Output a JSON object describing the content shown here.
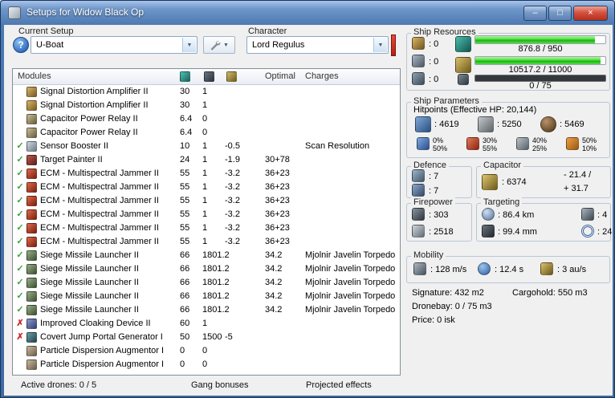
{
  "window": {
    "title": "Setups for Widow Black Op",
    "min_glyph": "–",
    "max_glyph": "□",
    "close_glyph": "×"
  },
  "controls": {
    "current_setup_label": "Current Setup",
    "setup_value": "U-Boat",
    "character_label": "Character",
    "character_value": "Lord Regulus",
    "help": "?",
    "dropdown_arrow": "▼"
  },
  "table": {
    "header": {
      "modules": "Modules",
      "optimal": "Optimal",
      "charges": "Charges"
    },
    "rows": [
      {
        "s": "",
        "name": "Signal Distortion Amplifier II",
        "cpu": "30",
        "qty": "1",
        "cap": "",
        "opt": "",
        "chg": ""
      },
      {
        "s": "",
        "name": "Signal Distortion Amplifier II",
        "cpu": "30",
        "qty": "1",
        "cap": "",
        "opt": "",
        "chg": ""
      },
      {
        "s": "",
        "name": "Capacitor Power Relay II",
        "cpu": "6.4",
        "qty": "0",
        "cap": "",
        "opt": "",
        "chg": ""
      },
      {
        "s": "",
        "name": "Capacitor Power Relay II",
        "cpu": "6.4",
        "qty": "0",
        "cap": "",
        "opt": "",
        "chg": ""
      },
      {
        "s": "✓",
        "name": "Sensor Booster II",
        "cpu": "10",
        "qty": "1",
        "cap": "-0.5",
        "opt": "",
        "chg": "Scan Resolution"
      },
      {
        "s": "✓",
        "name": "Target Painter II",
        "cpu": "24",
        "qty": "1",
        "cap": "-1.9",
        "opt": "30+78",
        "chg": ""
      },
      {
        "s": "✓",
        "name": "ECM - Multispectral Jammer II",
        "cpu": "55",
        "qty": "1",
        "cap": "-3.2",
        "opt": "36+23",
        "chg": ""
      },
      {
        "s": "✓",
        "name": "ECM - Multispectral Jammer II",
        "cpu": "55",
        "qty": "1",
        "cap": "-3.2",
        "opt": "36+23",
        "chg": ""
      },
      {
        "s": "✓",
        "name": "ECM - Multispectral Jammer II",
        "cpu": "55",
        "qty": "1",
        "cap": "-3.2",
        "opt": "36+23",
        "chg": ""
      },
      {
        "s": "✓",
        "name": "ECM - Multispectral Jammer II",
        "cpu": "55",
        "qty": "1",
        "cap": "-3.2",
        "opt": "36+23",
        "chg": ""
      },
      {
        "s": "✓",
        "name": "ECM - Multispectral Jammer II",
        "cpu": "55",
        "qty": "1",
        "cap": "-3.2",
        "opt": "36+23",
        "chg": ""
      },
      {
        "s": "✓",
        "name": "ECM - Multispectral Jammer II",
        "cpu": "55",
        "qty": "1",
        "cap": "-3.2",
        "opt": "36+23",
        "chg": ""
      },
      {
        "s": "✓",
        "name": "Siege Missile Launcher II",
        "cpu": "66",
        "qty": "1801.2",
        "cap": "",
        "opt": "34.2",
        "chg": "Mjolnir Javelin Torpedo"
      },
      {
        "s": "✓",
        "name": "Siege Missile Launcher II",
        "cpu": "66",
        "qty": "1801.2",
        "cap": "",
        "opt": "34.2",
        "chg": "Mjolnir Javelin Torpedo"
      },
      {
        "s": "✓",
        "name": "Siege Missile Launcher II",
        "cpu": "66",
        "qty": "1801.2",
        "cap": "",
        "opt": "34.2",
        "chg": "Mjolnir Javelin Torpedo"
      },
      {
        "s": "✓",
        "name": "Siege Missile Launcher II",
        "cpu": "66",
        "qty": "1801.2",
        "cap": "",
        "opt": "34.2",
        "chg": "Mjolnir Javelin Torpedo"
      },
      {
        "s": "✓",
        "name": "Siege Missile Launcher II",
        "cpu": "66",
        "qty": "1801.2",
        "cap": "",
        "opt": "34.2",
        "chg": "Mjolnir Javelin Torpedo"
      },
      {
        "s": "✗",
        "name": "Improved Cloaking Device II",
        "cpu": "60",
        "qty": "1",
        "cap": "",
        "opt": "",
        "chg": ""
      },
      {
        "s": "✗",
        "name": "Covert Jump Portal Generator I",
        "cpu": "50",
        "qty": "1500",
        "cap": "-5",
        "opt": "",
        "chg": ""
      },
      {
        "s": "",
        "name": "Particle Dispersion Augmentor I",
        "cpu": "0",
        "qty": "0",
        "cap": "",
        "opt": "",
        "chg": ""
      },
      {
        "s": "",
        "name": "Particle Dispersion Augmentor I",
        "cpu": "0",
        "qty": "0",
        "cap": "",
        "opt": "",
        "chg": ""
      }
    ]
  },
  "tabs": {
    "active_drones": "Active drones: 0 / 5",
    "gang_bonuses": "Gang bonuses",
    "projected_effects": "Projected effects"
  },
  "resources": {
    "title": "Ship Resources",
    "turrets": ": 0",
    "launchers": ": 0",
    "utility": ": 0",
    "cpu_text": "876.8 / 950",
    "cpu_pct": 92,
    "pg_text": "10517.2 / 11000",
    "pg_pct": 96,
    "cal_text": "0 / 75",
    "cal_pct": 0
  },
  "parameters": {
    "title": "Ship Parameters",
    "hitpoints": "Hitpoints (Effective HP: 20,144)",
    "shield": ": 4619",
    "armor": ": 5250",
    "hull": ": 5469",
    "resists": [
      {
        "top": "0%",
        "bottom": "50%"
      },
      {
        "top": "30%",
        "bottom": "55%"
      },
      {
        "top": "40%",
        "bottom": "25%"
      },
      {
        "top": "50%",
        "bottom": "10%"
      }
    ]
  },
  "defence": {
    "title": "Defence",
    "v1": ": 7",
    "v2": ": 7"
  },
  "capacitor": {
    "title": "Capacitor",
    "value": ": 6374",
    "drain": "- 21.4 /",
    "recharge": "+ 31.7"
  },
  "firepower": {
    "title": "Firepower",
    "volley": ": 303",
    "dps": ": 2518"
  },
  "targeting": {
    "title": "Targeting",
    "range": ": 86.4 km",
    "max_targets": ": 4",
    "scan_res": ": 99.4 mm",
    "sensor_str": ": 24"
  },
  "mobility": {
    "title": "Mobility",
    "speed": ": 128 m/s",
    "align": ": 12.4 s",
    "warp": ": 3 au/s"
  },
  "footer": {
    "signature": "Signature: 432 m2",
    "cargohold": "Cargohold: 550 m3",
    "dronebay": "Dronebay: 0 / 75 m3",
    "price": "Price: 0 isk"
  }
}
